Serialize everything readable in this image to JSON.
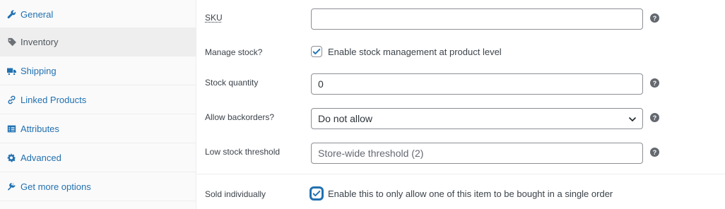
{
  "sidebar": {
    "items": [
      {
        "label": "General",
        "icon": "wrench-icon"
      },
      {
        "label": "Inventory",
        "icon": "tag-icon"
      },
      {
        "label": "Shipping",
        "icon": "truck-icon"
      },
      {
        "label": "Linked Products",
        "icon": "link-icon"
      },
      {
        "label": "Attributes",
        "icon": "list-icon"
      },
      {
        "label": "Advanced",
        "icon": "gear-icon"
      },
      {
        "label": "Get more options",
        "icon": "plugin-icon"
      }
    ],
    "active": "Inventory"
  },
  "inventory": {
    "sku": {
      "label": "SKU",
      "value": ""
    },
    "manage_stock": {
      "label": "Manage stock?",
      "checkbox_label": "Enable stock management at product level",
      "checked": true
    },
    "stock_quantity": {
      "label": "Stock quantity",
      "value": "0"
    },
    "backorders": {
      "label": "Allow backorders?",
      "selected": "Do not allow"
    },
    "low_stock": {
      "label": "Low stock threshold",
      "placeholder": "Store-wide threshold (2)"
    },
    "sold_individually": {
      "label": "Sold individually",
      "checkbox_label": "Enable this to only allow one of this item to be bought in a single order",
      "checked": true
    }
  },
  "help_icon_glyph": "?",
  "colors": {
    "link": "#2271b1",
    "checkbox_check": "#2271b1",
    "help_icon": "#646970"
  }
}
